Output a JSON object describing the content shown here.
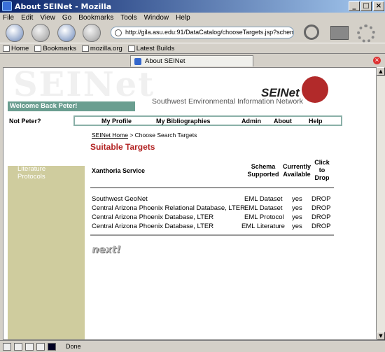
{
  "window": {
    "title": "About SEINet - Mozilla",
    "minimize": "_",
    "maximize": "□",
    "close": "×"
  },
  "menu": [
    "File",
    "Edit",
    "View",
    "Go",
    "Bookmarks",
    "Tools",
    "Window",
    "Help"
  ],
  "url": "http://gila.asu.edu:91/DataCatalog/chooseTargets.jsp?schema=",
  "personal_toolbar": [
    "Home",
    "Bookmarks",
    "mozilla.org",
    "Latest Builds"
  ],
  "tab": {
    "label": "About SEINet"
  },
  "page": {
    "watermark": "SEINet",
    "welcome": "Welcome Back Peter!",
    "logo_text": "SEINet",
    "network": "Southwest Environmental Information Network",
    "not_user": "Not Peter?",
    "nav": [
      "My Profile",
      "My Bibliographies",
      "Admin",
      "About",
      "Help"
    ],
    "breadcrumb": {
      "home": "SEINet Home",
      "sep": " > ",
      "current": "Choose Search Targets"
    },
    "title": "Suitable Targets",
    "sidebar": {
      "heading": "Research",
      "links": [
        "Datasets",
        "Literature",
        "Protocols"
      ]
    },
    "table": {
      "headers": {
        "service": "Xanthoria Service",
        "schema": "Schema Supported",
        "available": "Currently Available",
        "drop": "Click to Drop"
      },
      "rows": [
        {
          "service": "Southwest GeoNet",
          "schema": "EML Dataset",
          "available": "yes",
          "drop": "DROP"
        },
        {
          "service": "Central Arizona Phoenix Relational Database, LTER",
          "schema": "EML Dataset",
          "available": "yes",
          "drop": "DROP"
        },
        {
          "service": "Central Arizona Phoenix Database, LTER",
          "schema": "EML Protocol",
          "available": "yes",
          "drop": "DROP"
        },
        {
          "service": "Central Arizona Phoenix Database, LTER",
          "schema": "EML Literature",
          "available": "yes",
          "drop": "DROP"
        }
      ]
    },
    "next": "next!"
  },
  "status": {
    "text": "Done"
  }
}
